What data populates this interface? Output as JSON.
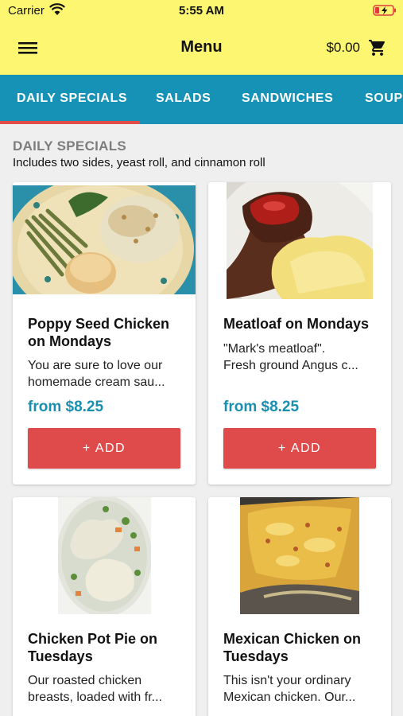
{
  "status_bar": {
    "carrier": "Carrier",
    "time": "5:55 AM"
  },
  "app_bar": {
    "title": "Menu",
    "cart_total": "$0.00"
  },
  "tabs": [
    {
      "label": "DAILY SPECIALS",
      "active": true
    },
    {
      "label": "SALADS"
    },
    {
      "label": "SANDWICHES"
    },
    {
      "label": "SOUP"
    }
  ],
  "section": {
    "title": "DAILY SPECIALS",
    "subtitle": "Includes two sides, yeast roll, and cinnamon roll"
  },
  "items": [
    {
      "name_lines": [
        "Poppy Seed Chicken",
        "on Mondays"
      ],
      "desc_lines": [
        "You are sure to love our",
        "homemade cream sau..."
      ],
      "price": "from $8.25",
      "add_label": "+ ADD"
    },
    {
      "name_lines": [
        "Meatloaf on Mondays"
      ],
      "desc_lines": [
        "\"Mark's meatloaf\".",
        "Fresh ground Angus c..."
      ],
      "price": "from $8.25",
      "add_label": "+ ADD"
    },
    {
      "name_lines": [
        "Chicken Pot Pie on",
        "Tuesdays"
      ],
      "desc_lines": [
        "Our roasted chicken",
        "breasts, loaded with fr..."
      ]
    },
    {
      "name_lines": [
        "Mexican Chicken on",
        "Tuesdays"
      ],
      "desc_lines": [
        "This isn't your ordinary",
        "Mexican chicken.  Our..."
      ]
    }
  ],
  "colors": {
    "app_bar": "#fcf671",
    "tab_bar": "#1592b5",
    "tab_indicator": "#e34a4a",
    "price": "#1a8fb0",
    "add_button": "#df4a4a",
    "background": "#efefef"
  }
}
